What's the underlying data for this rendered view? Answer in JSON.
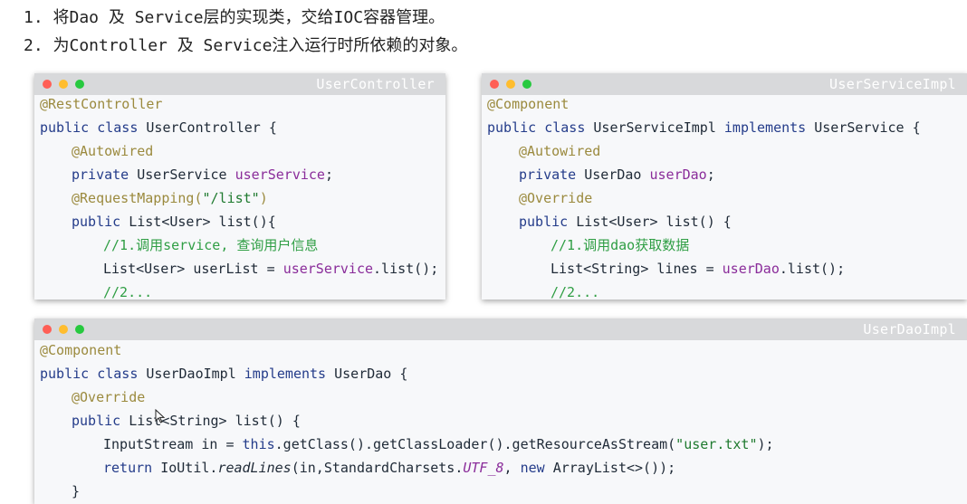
{
  "intro": {
    "line1": "1. 将Dao 及 Service层的实现类，交给IOC容器管理。",
    "line2": "2. 为Controller 及 Service注入运行时所依赖的对象。"
  },
  "windows": {
    "controller": {
      "title": "UserController",
      "lines": {
        "l1": "@RestController",
        "l2a": "public class ",
        "l2b": "UserController {",
        "l3": "@Autowired",
        "l4a": "private ",
        "l4b": "UserService ",
        "l4c": "userService",
        "l4d": ";",
        "l5a": "@RequestMapping(",
        "l5b": "\"/list\"",
        "l5c": ")",
        "l6a": "public ",
        "l6b": "List<User> list(){",
        "l7": "//1.调用service, 查询用户信息",
        "l8a": "List<User> userList = ",
        "l8b": "userService",
        "l8c": ".list();",
        "l9": "//2..."
      }
    },
    "service": {
      "title": "UserServiceImpl",
      "lines": {
        "l1": "@Component",
        "l2a": "public class ",
        "l2b": "UserServiceImpl ",
        "l2c": "implements ",
        "l2d": "UserService {",
        "l3": "@Autowired",
        "l4a": "private ",
        "l4b": "UserDao ",
        "l4c": "userDao",
        "l4d": ";",
        "l5": "@Override",
        "l6a": "public ",
        "l6b": "List<User> list() {",
        "l7": "//1.调用dao获取数据",
        "l8a": "List<String> lines = ",
        "l8b": "userDao",
        "l8c": ".list();",
        "l9": "//2..."
      }
    },
    "dao": {
      "title": "UserDaoImpl",
      "lines": {
        "l1": "@Component",
        "l2a": "public class ",
        "l2b": "UserDaoImpl ",
        "l2c": "implements ",
        "l2d": "UserDao {",
        "l3": "@Override",
        "l4a": "public ",
        "l4b": "List<String> list() {",
        "l5a": "InputStream in = ",
        "l5b": "this",
        "l5c": ".getClass().getClassLoader().getResourceAsStream(",
        "l5d": "\"user.txt\"",
        "l5e": ");",
        "l6a": "return ",
        "l6b": "IoUtil.",
        "l6c": "readLines",
        "l6d": "(in,StandardCharsets.",
        "l6e": "UTF_8",
        "l6f": ", ",
        "l6g": "new ",
        "l6h": "ArrayList<>());",
        "l7": "}"
      }
    }
  },
  "colors": {
    "annotation": "#9b8a3e",
    "keyword": "#243c8a",
    "field": "#8a2c9a",
    "string": "#1f7a2f",
    "comment": "#2f9e44"
  }
}
